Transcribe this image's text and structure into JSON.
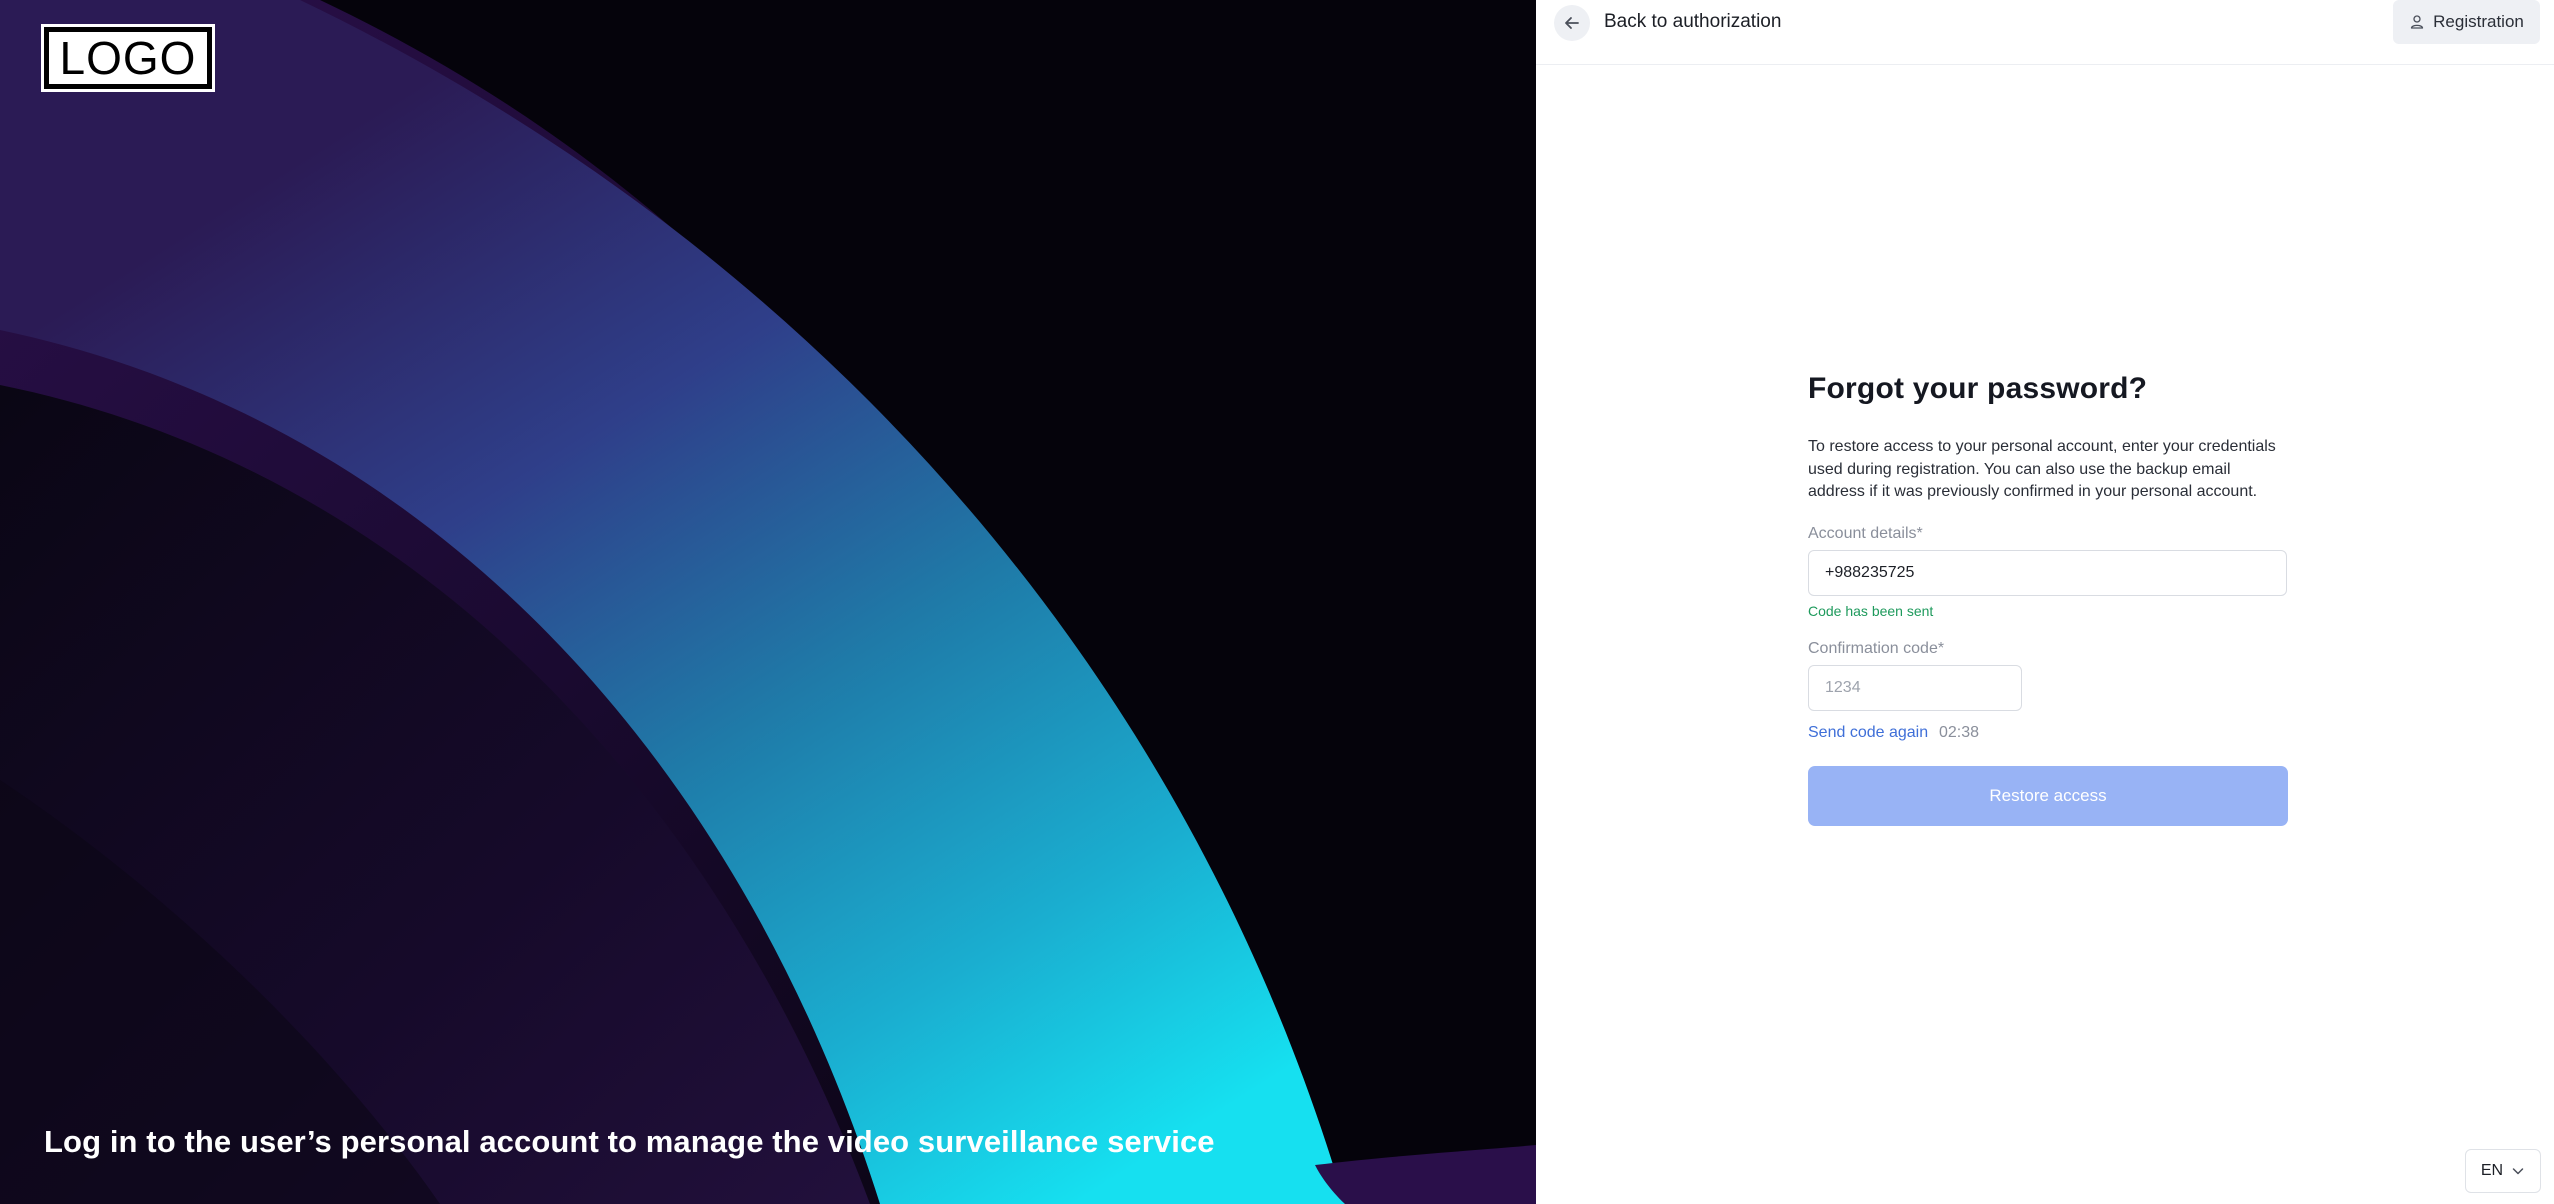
{
  "hero": {
    "logo_text": "LOGO",
    "caption": "Log in to the user’s personal account to manage the video surveillance service"
  },
  "topbar": {
    "back_label": "Back to authorization",
    "back_icon": "arrow-left-icon",
    "registration_label": "Registration",
    "registration_icon": "user-icon"
  },
  "form": {
    "title": "Forgot your password?",
    "description": "To restore access to your personal account, enter your credentials used during registration. You can also use the backup email address if it was previously confirmed in your personal account.",
    "account_label": "Account details",
    "account_value": "+988235725",
    "code_sent_message": "Code has been sent",
    "code_label": "Confirmation code",
    "code_placeholder": "1234",
    "required_mark": "*",
    "resend_label": "Send code again",
    "timer": "02:38",
    "submit_label": "Restore access"
  },
  "language": {
    "selected": "EN",
    "icon": "chevron-down-icon"
  },
  "colors": {
    "accent": "#3f6fd8",
    "button_disabled": "#98b3f5",
    "success": "#1e9a5c"
  }
}
